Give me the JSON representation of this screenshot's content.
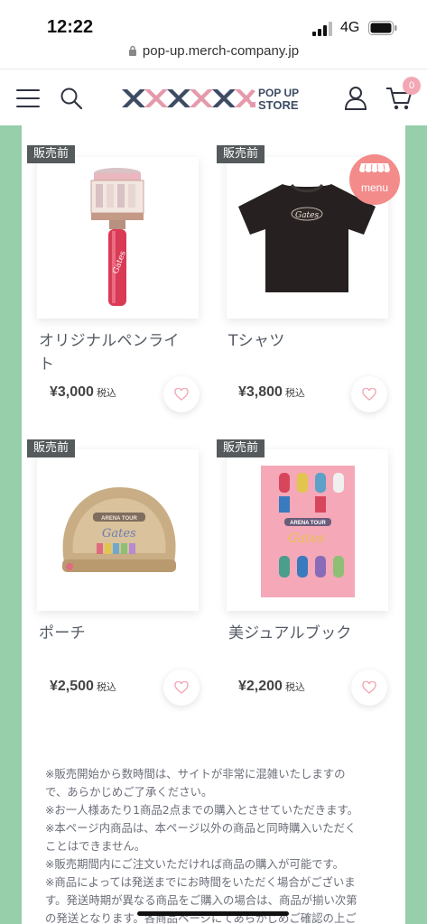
{
  "status": {
    "time": "12:22",
    "network": "4G"
  },
  "browser": {
    "url": "pop-up.merch-company.jp"
  },
  "header": {
    "logo_text": "POP UP STORE",
    "logo_line1": "POP UP",
    "logo_line2": "STORE",
    "cart_count": "0"
  },
  "menu_button": {
    "label": "menu"
  },
  "products": [
    {
      "badge": "販売前",
      "name": "オリジナルペンライト",
      "name_line1": "オリジナルペンライ",
      "name_line2": "ト",
      "price": "¥3,000",
      "tax": "税込"
    },
    {
      "badge": "販売前",
      "name": "Tシャツ",
      "name_line1": "Tシャツ",
      "name_line2": "",
      "price": "¥3,800",
      "tax": "税込"
    },
    {
      "badge": "販売前",
      "name": "ポーチ",
      "name_line1": "ポーチ",
      "name_line2": "",
      "price": "¥2,500",
      "tax": "税込"
    },
    {
      "badge": "販売前",
      "name": "美ジュアルブック",
      "name_line1": "美ジュアルブック",
      "name_line2": "",
      "price": "¥2,200",
      "tax": "税込"
    }
  ],
  "product_art": {
    "brand_script": "Gates",
    "tour_label": "ARENA TOUR"
  },
  "notes": [
    "※販売開始から数時間は、サイトが非常に混雑いたしますの",
    "で、あらかじめご了承ください。",
    "※お一人様あたり1商品2点までの購入とさせていただきます。",
    "※本ページ内商品は、本ページ以外の商品と同時購入いただく",
    "ことはできません。",
    "※販売期間内にご注文いただければ商品の購入が可能です。",
    "※商品によっては発送までにお時間をいただく場合がございま",
    "す。発送時期が異なる商品をご購入の場合は、商品が揃い次第",
    "の発送となります。各商品ページにてあらかじめご確認の上ご"
  ],
  "colors": {
    "accent_green": "#96cfaa",
    "badge_gray": "#555a5c",
    "heart_pink": "#f3a7b4",
    "menu_coral": "#f38b8b"
  }
}
